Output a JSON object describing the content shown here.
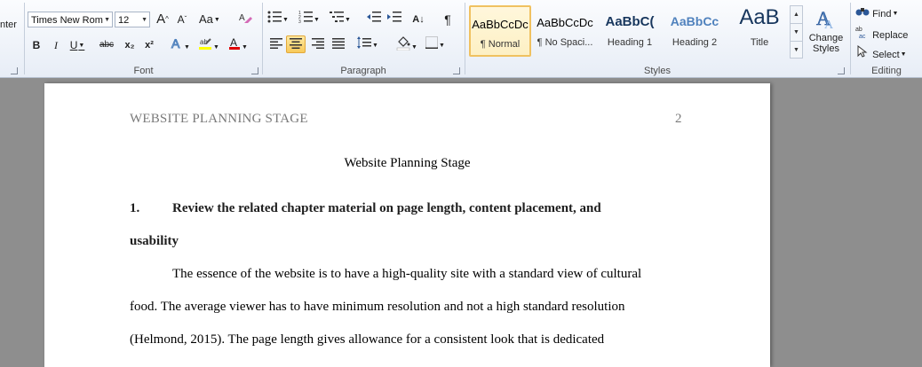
{
  "ribbon": {
    "clipboard": {
      "paste_label_fragment": "nter"
    },
    "font": {
      "font_name": "Times New Rom",
      "font_size": "12",
      "grow_font": "A",
      "shrink_font": "A",
      "change_case": "Aa",
      "bold": "B",
      "italic": "I",
      "underline": "U",
      "strikethrough": "abc",
      "subscript": "x₂",
      "superscript": "x²",
      "group_label": "Font"
    },
    "paragraph": {
      "sort": "A↓",
      "show_marks": "¶",
      "group_label": "Paragraph"
    },
    "styles": {
      "items": [
        {
          "sample": "AaBbCcDc",
          "name": "¶ Normal"
        },
        {
          "sample": "AaBbCcDc",
          "name": "¶ No Spaci..."
        },
        {
          "sample": "AaBbC(",
          "name": "Heading 1"
        },
        {
          "sample": "AaBbCc",
          "name": "Heading 2"
        },
        {
          "sample": "AaB",
          "name": "Title"
        }
      ],
      "change_styles": "Change Styles",
      "group_label": "Styles"
    },
    "editing": {
      "find": "Find",
      "replace": "Replace",
      "select": "Select",
      "group_label": "Editing"
    }
  },
  "colors": {
    "accent_highlight": "#f8c95a",
    "font_color": "#e00000",
    "heading_color": "#17365d",
    "heading2_color": "#4f81bd"
  },
  "document": {
    "header_title": "WEBSITE PLANNING STAGE",
    "page_number": "2",
    "title": "Website Planning Stage",
    "question_number": "1.",
    "question_text": "Review the related chapter material on page length, content placement, and",
    "question_text_cont": "usability",
    "paragraph_lines": [
      "The essence of the website is to have a high-quality site with a standard view of cultural",
      "food.   The average viewer has to have minimum  resolution and not a high standard resolution",
      "(Helmond, 2015). The page length gives allowance for a consistent look that is  dedicated"
    ]
  }
}
